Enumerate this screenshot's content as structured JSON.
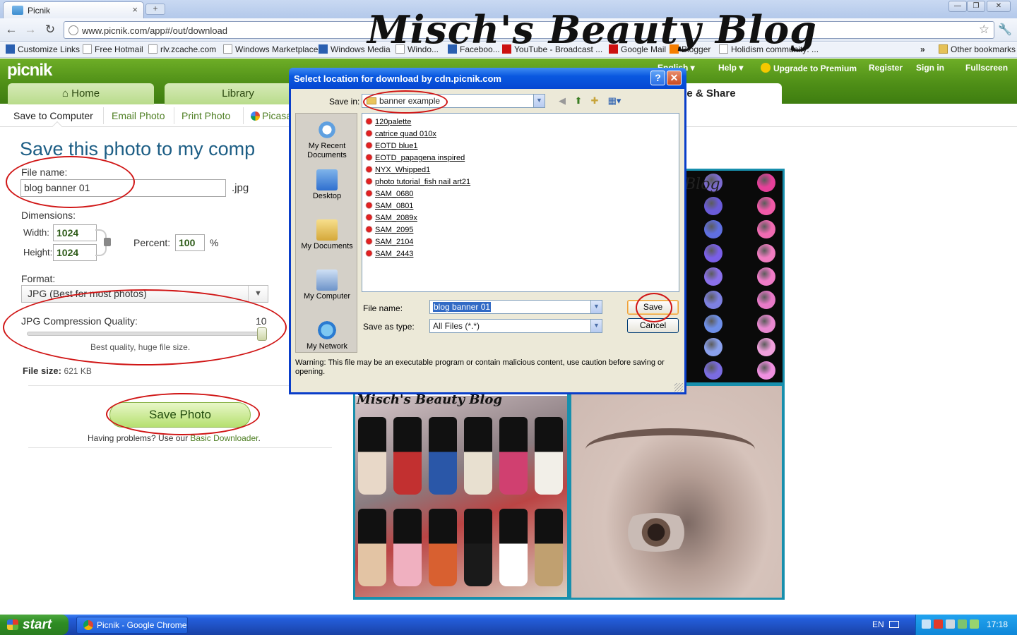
{
  "overlay_title": "Misch's Beauty Blog",
  "browser": {
    "tab_title": "Picnik",
    "tab_close": "×",
    "new_tab": "+",
    "url": "www.picnik.com/app#/out/download",
    "bookmarks": [
      "Customize Links",
      "Free Hotmail",
      "rlv.zcache.com",
      "Windows Marketplace",
      "Windows Media",
      "Windo...",
      "Faceboo...",
      "YouTube - Broadcast ...",
      "Google Mail",
      "Blogger",
      "Holidism community: ..."
    ],
    "bookmarks_more": "»",
    "other_bookmarks": "Other bookmarks"
  },
  "picnik": {
    "logo": "picnik",
    "tabs": [
      "Home",
      "Library",
      "ve & Share"
    ],
    "top_links": [
      "English",
      "Help",
      "Upgrade to Premium",
      "Register",
      "Sign in",
      "Fullscreen"
    ],
    "subtabs": [
      "Save to Computer",
      "Email Photo",
      "Print Photo",
      "Picasa"
    ],
    "save_panel": {
      "title": "Save this photo to my comp",
      "file_name_label": "File name:",
      "file_name_value": "blog banner 01",
      "ext": ".jpg",
      "dimensions_label": "Dimensions:",
      "width_label": "Width:",
      "width_value": "1024",
      "height_label": "Height:",
      "height_value": "1024",
      "percent_label": "Percent:",
      "percent_value": "100",
      "percent_unit": "%",
      "format_label": "Format:",
      "format_value": "JPG (Best for most photos)",
      "quality_label": "JPG Compression Quality:",
      "quality_value": "10",
      "quality_level": 1.0,
      "quality_hint": "Best quality, huge file size.",
      "filesize_label": "File size:",
      "filesize_value": "621 KB",
      "save_button": "Save Photo",
      "problems_text": "Having problems? Use our",
      "basic_downloader": "Basic Downloader",
      "period": "."
    },
    "collage_caption": "Misch's Beauty Blog",
    "palette_caption": "Blog"
  },
  "dialog": {
    "title": "Select location for download by cdn.picnik.com",
    "help": "?",
    "close": "✕",
    "save_in_label": "Save in:",
    "save_in_value": "banner example",
    "places": [
      "My Recent Documents",
      "Desktop",
      "My Documents",
      "My Computer",
      "My Network"
    ],
    "files": [
      "120palette",
      "catrice quad 010x",
      "EOTD blue1",
      "EOTD_papagena inspired",
      "NYX_Whipped1",
      "photo tutorial_fish nail art21",
      "SAM_0680",
      "SAM_0801",
      "SAM_2089x",
      "SAM_2095",
      "SAM_2104",
      "SAM_2443"
    ],
    "file_name_label": "File name:",
    "file_name_value": "blog banner 01",
    "save_type_label": "Save as type:",
    "save_type_value": "All Files (*.*)",
    "save_button": "Save",
    "cancel_button": "Cancel",
    "warning": "Warning: This file may be an executable program or contain malicious content, use caution before saving or opening."
  },
  "taskbar": {
    "start": "start",
    "task": "Picnik - Google Chrome",
    "lang": "EN",
    "clock": "17:18"
  },
  "colors": {
    "markup": "#d01515",
    "picnik_green": "#4f8f17",
    "xp_blue": "#0a58e0"
  }
}
